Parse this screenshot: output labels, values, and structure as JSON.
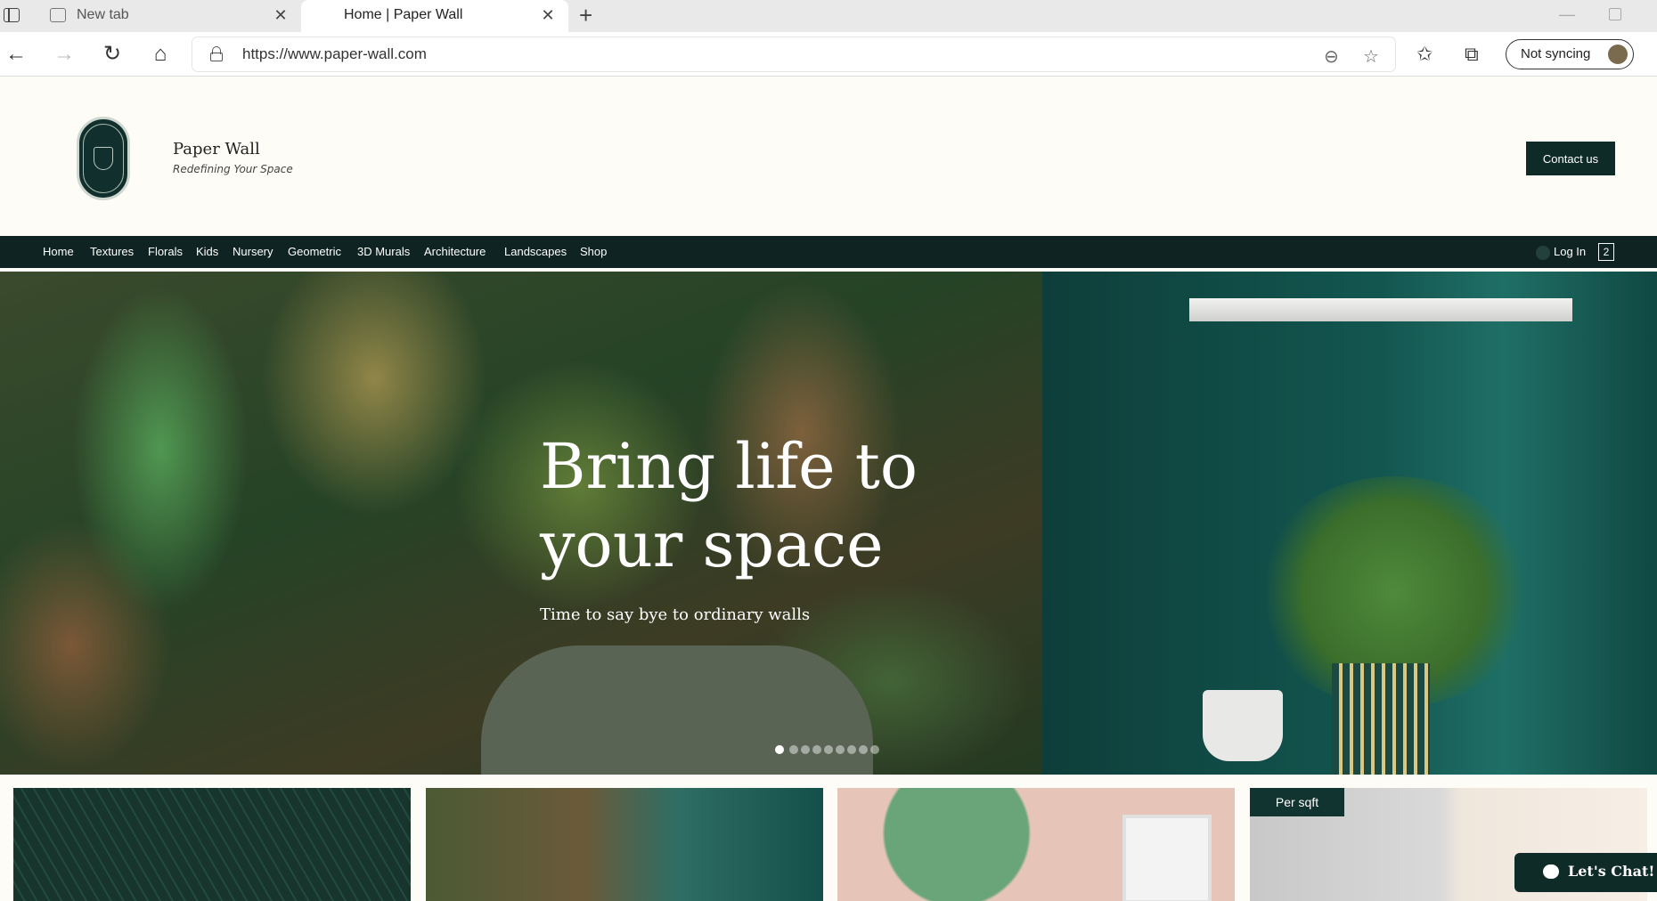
{
  "browser": {
    "tabs": [
      {
        "title": "New tab"
      },
      {
        "title": "Home | Paper Wall"
      }
    ],
    "url": "https://www.paper-wall.com",
    "sync_label": "Not syncing"
  },
  "header": {
    "site_title": "Paper Wall",
    "tagline": "Redefining Your Space",
    "contact_label": "Contact us"
  },
  "nav": {
    "items": [
      "Home",
      "Textures",
      "Florals",
      "Kids",
      "Nursery",
      "Geometric",
      "3D Murals",
      "Architecture",
      "Landscapes",
      "Shop"
    ],
    "login_label": "Log In",
    "cart_count": "2"
  },
  "hero": {
    "title_line1": "Bring life to",
    "title_line2": "your space",
    "subtitle": "Time to say bye to ordinary walls",
    "slide_count": 9,
    "active_slide": 1
  },
  "tiles": {
    "badge": "Per sqft"
  },
  "chat": {
    "label": "Let's Chat!"
  }
}
